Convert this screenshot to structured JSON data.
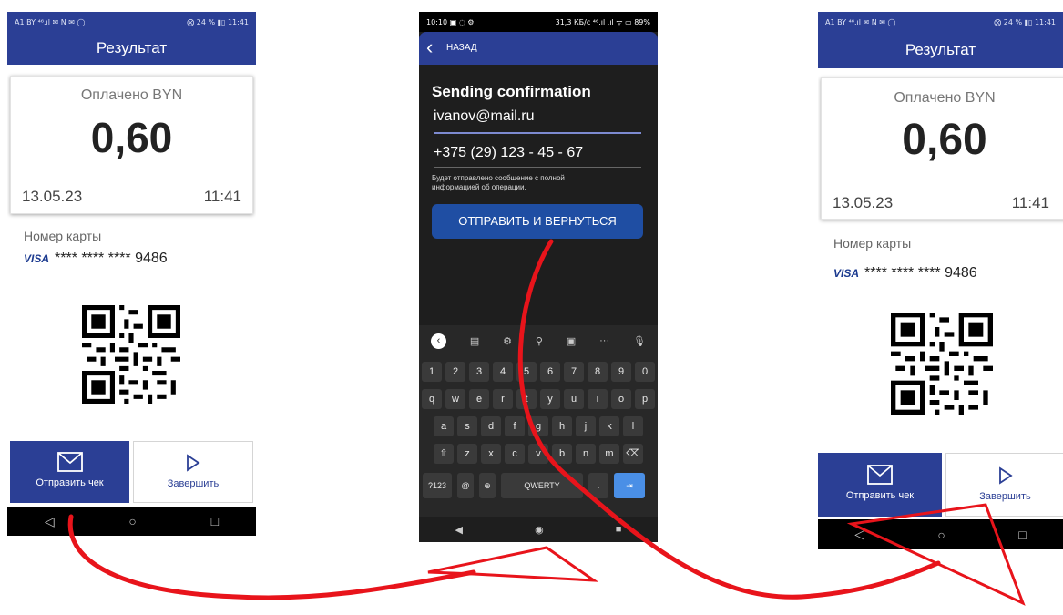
{
  "screen_left": {
    "status_left": "A1 BY ⁴⁶.ıl ✉ N ✉ ◯",
    "status_right": "⨂ 24 % ▮▯ 11:41",
    "header": "Результат",
    "paid_label": "Оплачено BYN",
    "amount": "0,60",
    "date": "13.05.23",
    "time": "11:41",
    "card_label": "Номер карты",
    "card_brand": "VISA",
    "card_number": "**** **** **** 9486",
    "send_label": "Отправить чек",
    "finish_label": "Завершить",
    "nav": [
      "◁",
      "○",
      "□"
    ]
  },
  "screen_middle": {
    "status_left": "10:10 ▣ ◌ ⚙",
    "status_right": "31,3 КБ/с ⁴⁶.ıl .ıl ᯤ ▭ 89%",
    "back_label": "НАЗАД",
    "title": "Sending confirmation",
    "email_value": "ivanov@mail.ru",
    "phone_value": "+375 (29) 123 - 45 - 67",
    "info_text_line1": "Будет отправлено сообщение с полной",
    "info_text_line2": "информацией об операции.",
    "submit_label": "ОТПРАВИТЬ И ВЕРНУТЬСЯ",
    "toolbar_icons": [
      "‹",
      "▤",
      "⚙",
      "⚲",
      "▣",
      "···",
      "🎙"
    ],
    "keyboard_rows": [
      [
        "1",
        "2",
        "3",
        "4",
        "5",
        "6",
        "7",
        "8",
        "9",
        "0"
      ],
      [
        "q",
        "w",
        "e",
        "r",
        "t",
        "y",
        "u",
        "i",
        "o",
        "p"
      ],
      [
        "a",
        "s",
        "d",
        "f",
        "g",
        "h",
        "j",
        "k",
        "l"
      ],
      [
        "⇧",
        "z",
        "x",
        "c",
        "v",
        "b",
        "n",
        "m",
        "⌫"
      ]
    ],
    "bottom_row": [
      "?123",
      "@",
      "⊕",
      "QWERTY",
      ".",
      "⇥"
    ],
    "nav": [
      "◀",
      "◉",
      "■"
    ]
  },
  "screen_right": {
    "status_left": "A1 BY ⁴⁶.ıl ✉ N ✉ ◯",
    "status_right": "⨂ 24 % ▮▯ 11:41",
    "header": "Результат",
    "paid_label": "Оплачено BYN",
    "amount": "0,60",
    "date": "13.05.23",
    "time": "11:41",
    "card_label": "Номер карты",
    "card_brand": "VISA",
    "card_number": "**** **** **** 9486",
    "send_label": "Отправить чек",
    "finish_label": "Завершить",
    "nav": [
      "◁",
      "○",
      "□"
    ]
  },
  "colors": {
    "brand_blue": "#2b3f95",
    "arrow_red": "#e8141b",
    "submit_blue": "#1f4ea3"
  }
}
